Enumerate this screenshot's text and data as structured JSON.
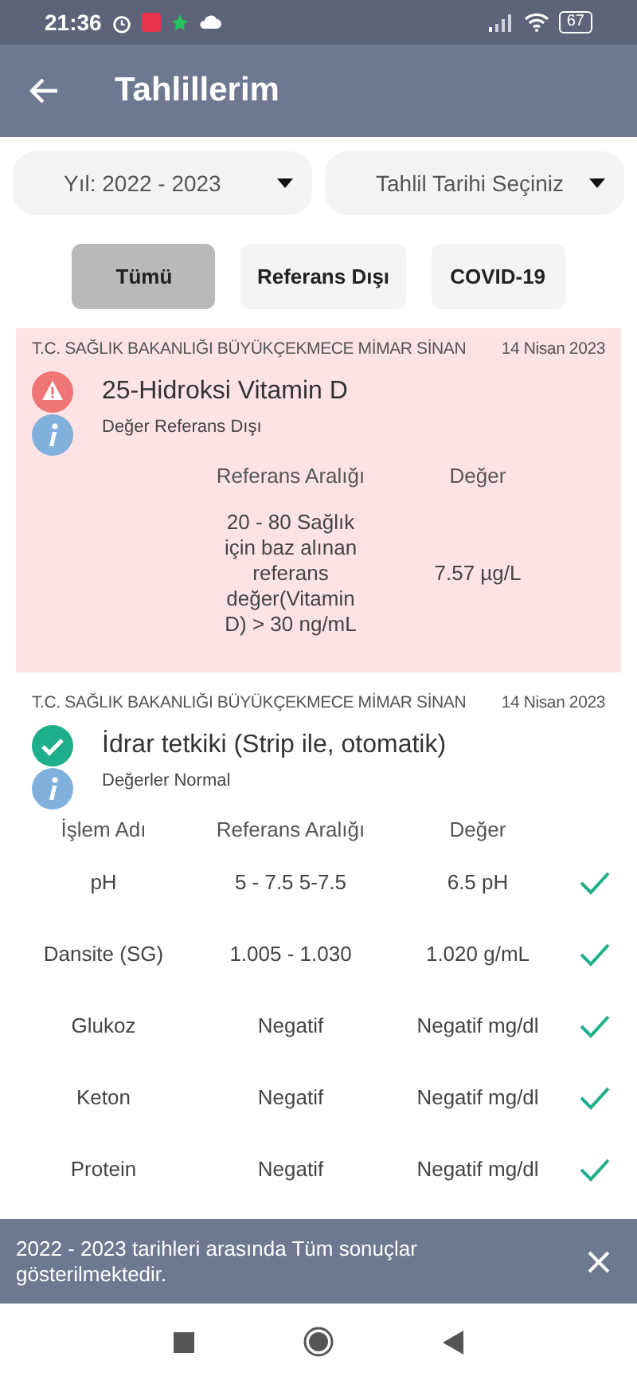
{
  "status_bar": {
    "time": "21:36",
    "battery": "67"
  },
  "header": {
    "title": "Tahlillerim"
  },
  "filters": [
    {
      "label": "Yıl: 2022 - 2023"
    },
    {
      "label": "Tahlil Tarihi Seçiniz"
    }
  ],
  "tabs": [
    {
      "label": "Tümü",
      "selected": true
    },
    {
      "label": "Referans Dışı",
      "selected": false
    },
    {
      "label": "COVID-19",
      "selected": false
    }
  ],
  "results": [
    {
      "kind": "abnormal",
      "institution": "T.C. SAĞLIK BAKANLIĞI BÜYÜKÇEKMECE MİMAR SİNAN",
      "date": "14 Nisan 2023",
      "test_name": "25-Hidroksi Vitamin D",
      "status_text": "Değer Referans Dışı",
      "columns": [
        {
          "kind": "reference",
          "label": "Referans Aralığı"
        },
        {
          "kind": "value",
          "label": "Değer"
        }
      ],
      "rows": [
        {
          "reference": "20 - 80 Sağlık için baz alınan referans değer(Vitamin D) > 30 ng/mL",
          "value": "7.57 µg/L",
          "normal": false
        }
      ]
    },
    {
      "kind": "normal",
      "institution": "T.C. SAĞLIK BAKANLIĞI BÜYÜKÇEKMECE MİMAR SİNAN",
      "date": "14 Nisan 2023",
      "test_name": "İdrar tetkiki (Strip ile, otomatik)",
      "status_text": "Değerler Normal",
      "columns": [
        {
          "kind": "name",
          "label": "İşlem Adı"
        },
        {
          "kind": "reference",
          "label": "Referans Aralığı"
        },
        {
          "kind": "value",
          "label": "Değer"
        }
      ],
      "rows": [
        {
          "name": "pH",
          "reference": "5 - 7.5 5-7.5",
          "value": "6.5 pH",
          "normal": true
        },
        {
          "name": "Dansite (SG)",
          "reference": "1.005 - 1.030",
          "value": "1.020 g/mL",
          "normal": true
        },
        {
          "name": "Glukoz",
          "reference": "Negatif",
          "value": "Negatif mg/dl",
          "normal": true
        },
        {
          "name": "Keton",
          "reference": "Negatif",
          "value": "Negatif mg/dl",
          "normal": true
        },
        {
          "name": "Protein",
          "reference": "Negatif",
          "value": "Negatif mg/dl",
          "normal": true
        }
      ]
    }
  ],
  "snackbar": {
    "message": "2022 - 2023 tarihleri arasında Tüm sonuçlar gösterilmektedir."
  }
}
